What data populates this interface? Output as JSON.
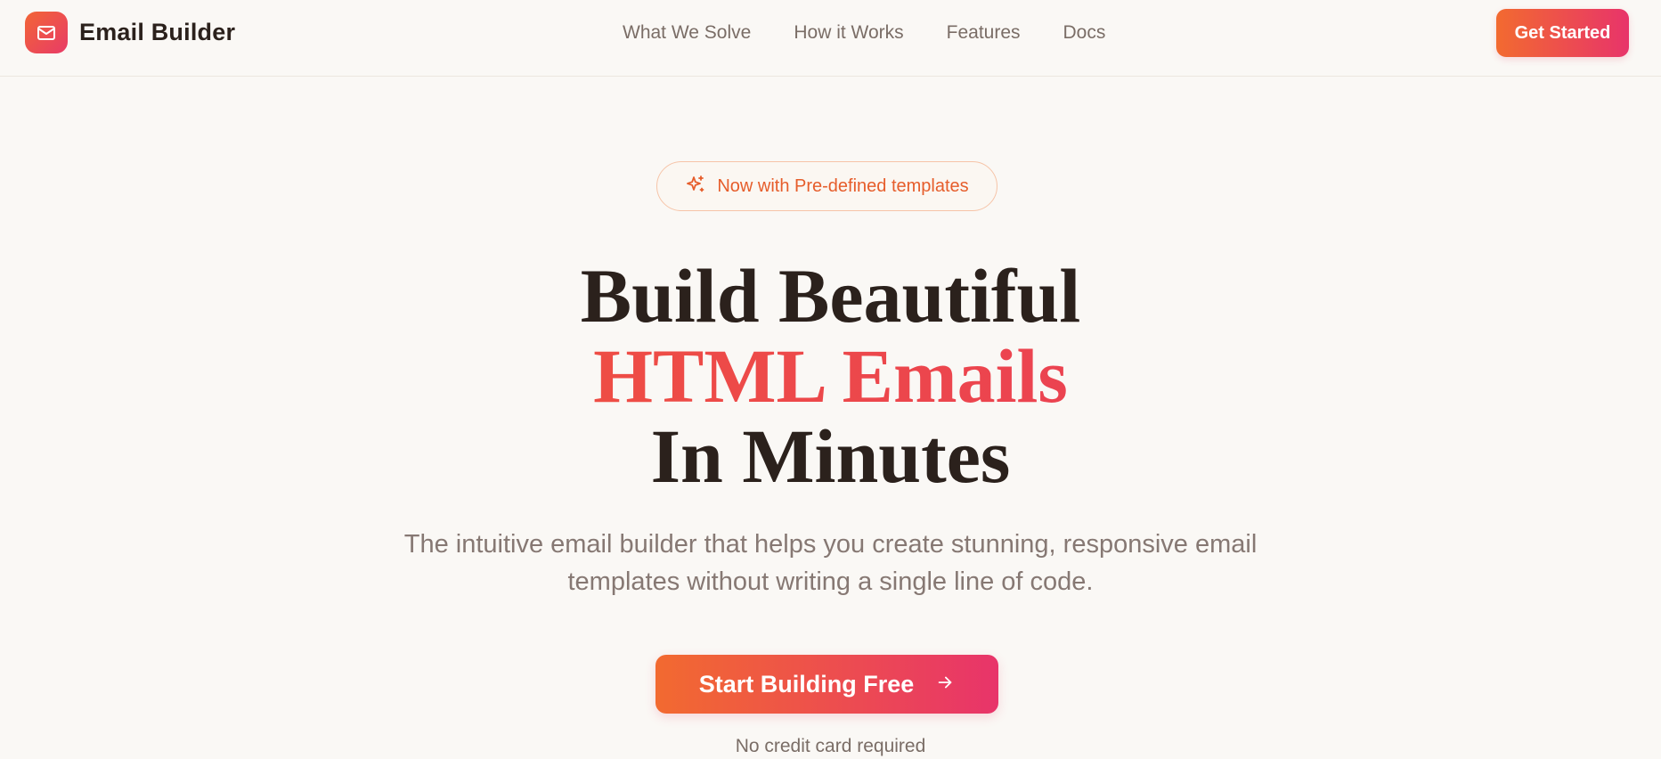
{
  "brand": {
    "name": "Email Builder",
    "icon": "mail-icon"
  },
  "nav": {
    "links": [
      "What We Solve",
      "How it Works",
      "Features",
      "Docs"
    ],
    "cta_label": "Get Started"
  },
  "hero": {
    "badge": {
      "icon": "sparkles-icon",
      "text": "Now with Pre-defined templates"
    },
    "title_line1": "Build Beautiful",
    "title_line2": "HTML Emails",
    "title_line3": "In Minutes",
    "subtitle": "The intuitive email builder that helps you create stunning, responsive email templates without writing a single line of code.",
    "cta_label": "Start Building Free",
    "cta_icon": "arrow-right-icon",
    "note": "No credit card required"
  },
  "colors": {
    "background": "#faf8f5",
    "accent_start": "#f26a30",
    "accent_end": "#e8346a",
    "text_dark": "#2b211c",
    "text_muted": "#867873"
  }
}
